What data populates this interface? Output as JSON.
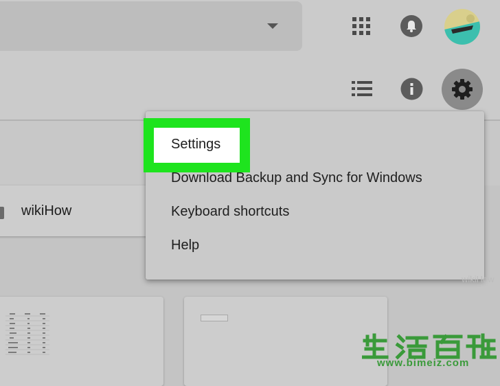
{
  "header": {
    "search_dropdown_icon": "caret-down-icon",
    "apps_icon": "grid-icon",
    "notifications_icon": "bell-icon",
    "account_icon": "avatar"
  },
  "toolbar": {
    "view_icon": "list-view-icon",
    "info_icon": "info-icon",
    "settings_icon": "gear-icon"
  },
  "folder": {
    "name": "wikiHow"
  },
  "settings_menu": {
    "items": [
      "Settings",
      "Download Backup and Sync for Windows",
      "Keyboard shortcuts",
      "Help"
    ]
  },
  "watermark": {
    "url": "www.bimeiz.com",
    "faint": "wikiHow"
  },
  "colors": {
    "highlight": "#1ee41e",
    "page_bg": "#c4c4c4",
    "menu_bg": "#cacaca",
    "watermark_green": "#3a9a3a"
  }
}
